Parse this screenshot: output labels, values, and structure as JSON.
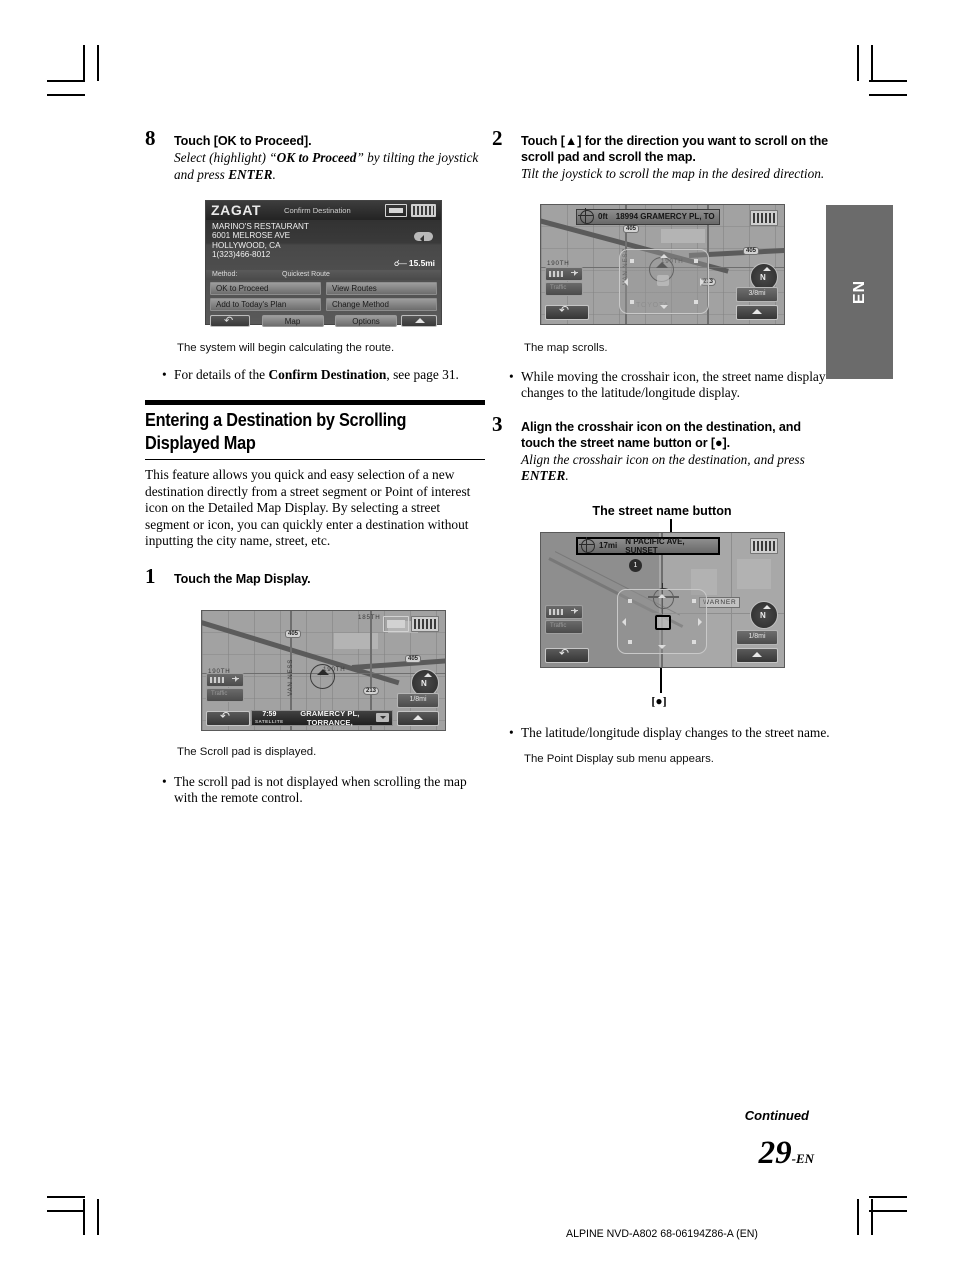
{
  "page": {
    "language_tab": "EN",
    "continued_label": "Continued",
    "page_number": "29",
    "page_number_suffix": "-EN",
    "doc_id": "ALPINE NVD-A802 68-06194Z86-A (EN)"
  },
  "left_column": {
    "step8": {
      "number": "8",
      "title": "Touch [OK to Proceed].",
      "subtitle": "Select (highlight) \"OK to Proceed\" by tilting the joystick and press ENTER.",
      "result_note": "The system will begin calculating the route.",
      "bullet": "For details of the Confirm Destination, see page 31."
    },
    "confirm_screen": {
      "brand": "ZAGAT",
      "title": "Confirm Destination",
      "lines": [
        "MARINO'S RESTAURANT",
        "6001 MELROSE AVE",
        "HOLLYWOOD, CA",
        "1(323)466-8012"
      ],
      "distance": "15.5mi",
      "method_label": "Method:",
      "method_value": "Quickest Route",
      "buttons": [
        "OK to Proceed",
        "View Routes",
        "Add to Today's Plan",
        "Change Method"
      ],
      "map_button": "Map",
      "options_button": "Options"
    },
    "section": {
      "heading": "Entering a Destination by Scrolling\nDisplayed Map",
      "paragraph": "This feature allows you quick and easy selection of a new destination directly from a street segment or Point of interest icon on the Detailed Map Display. By selecting a street segment or icon, you can quickly enter a destination without inputting the city name, street, etc."
    },
    "step1": {
      "number": "1",
      "title": "Touch the Map Display.",
      "result_note": "The Scroll pad is displayed.",
      "bullet": "The scroll pad is not displayed when scrolling the map with the remote control."
    },
    "map1": {
      "street_name": "GRAMERCY PL, TORRANCE,",
      "time": "7:59",
      "time_sub": "SATELLITE",
      "scale": "1/8mi",
      "compass": "N",
      "road_labels": [
        "405",
        "405",
        "190TH",
        "190TH",
        "VAN NESS",
        "185TH",
        "213"
      ]
    }
  },
  "right_column": {
    "step2": {
      "number": "2",
      "title": "Touch [▲] for the direction you want to scroll on the scroll pad and scroll the map.",
      "subtitle": "Tilt the joystick to scroll the map in the desired direction.",
      "result_note": "The map scrolls.",
      "bullet": "While moving the crosshair icon, the street name display changes to the latitude/longitude display."
    },
    "map2": {
      "distance": "0ft",
      "street_name": "18994 GRAMERCY PL, TO",
      "scale": "3/8mi",
      "compass": "N",
      "road_labels": [
        "405",
        "405",
        "190TH",
        "190TH",
        "VAN NESS",
        "213",
        "TOYOTA"
      ]
    },
    "step3": {
      "number": "3",
      "title": "Align the crosshair icon on the destination, and touch the street name button or [●].",
      "subtitle": "Align the crosshair icon on the destination, and press ENTER.",
      "callout_top": "The street name button",
      "callout_bottom": "[●]",
      "bullet": "The latitude/longitude display changes to the street name.",
      "result_note": "The Point Display sub menu appears."
    },
    "map3": {
      "distance": "17mi",
      "street_name": "N PACIFIC AVE, SUNSET",
      "scale": "1/8mi",
      "compass": "N",
      "poi_label": "WARNER",
      "marker": "1"
    }
  }
}
